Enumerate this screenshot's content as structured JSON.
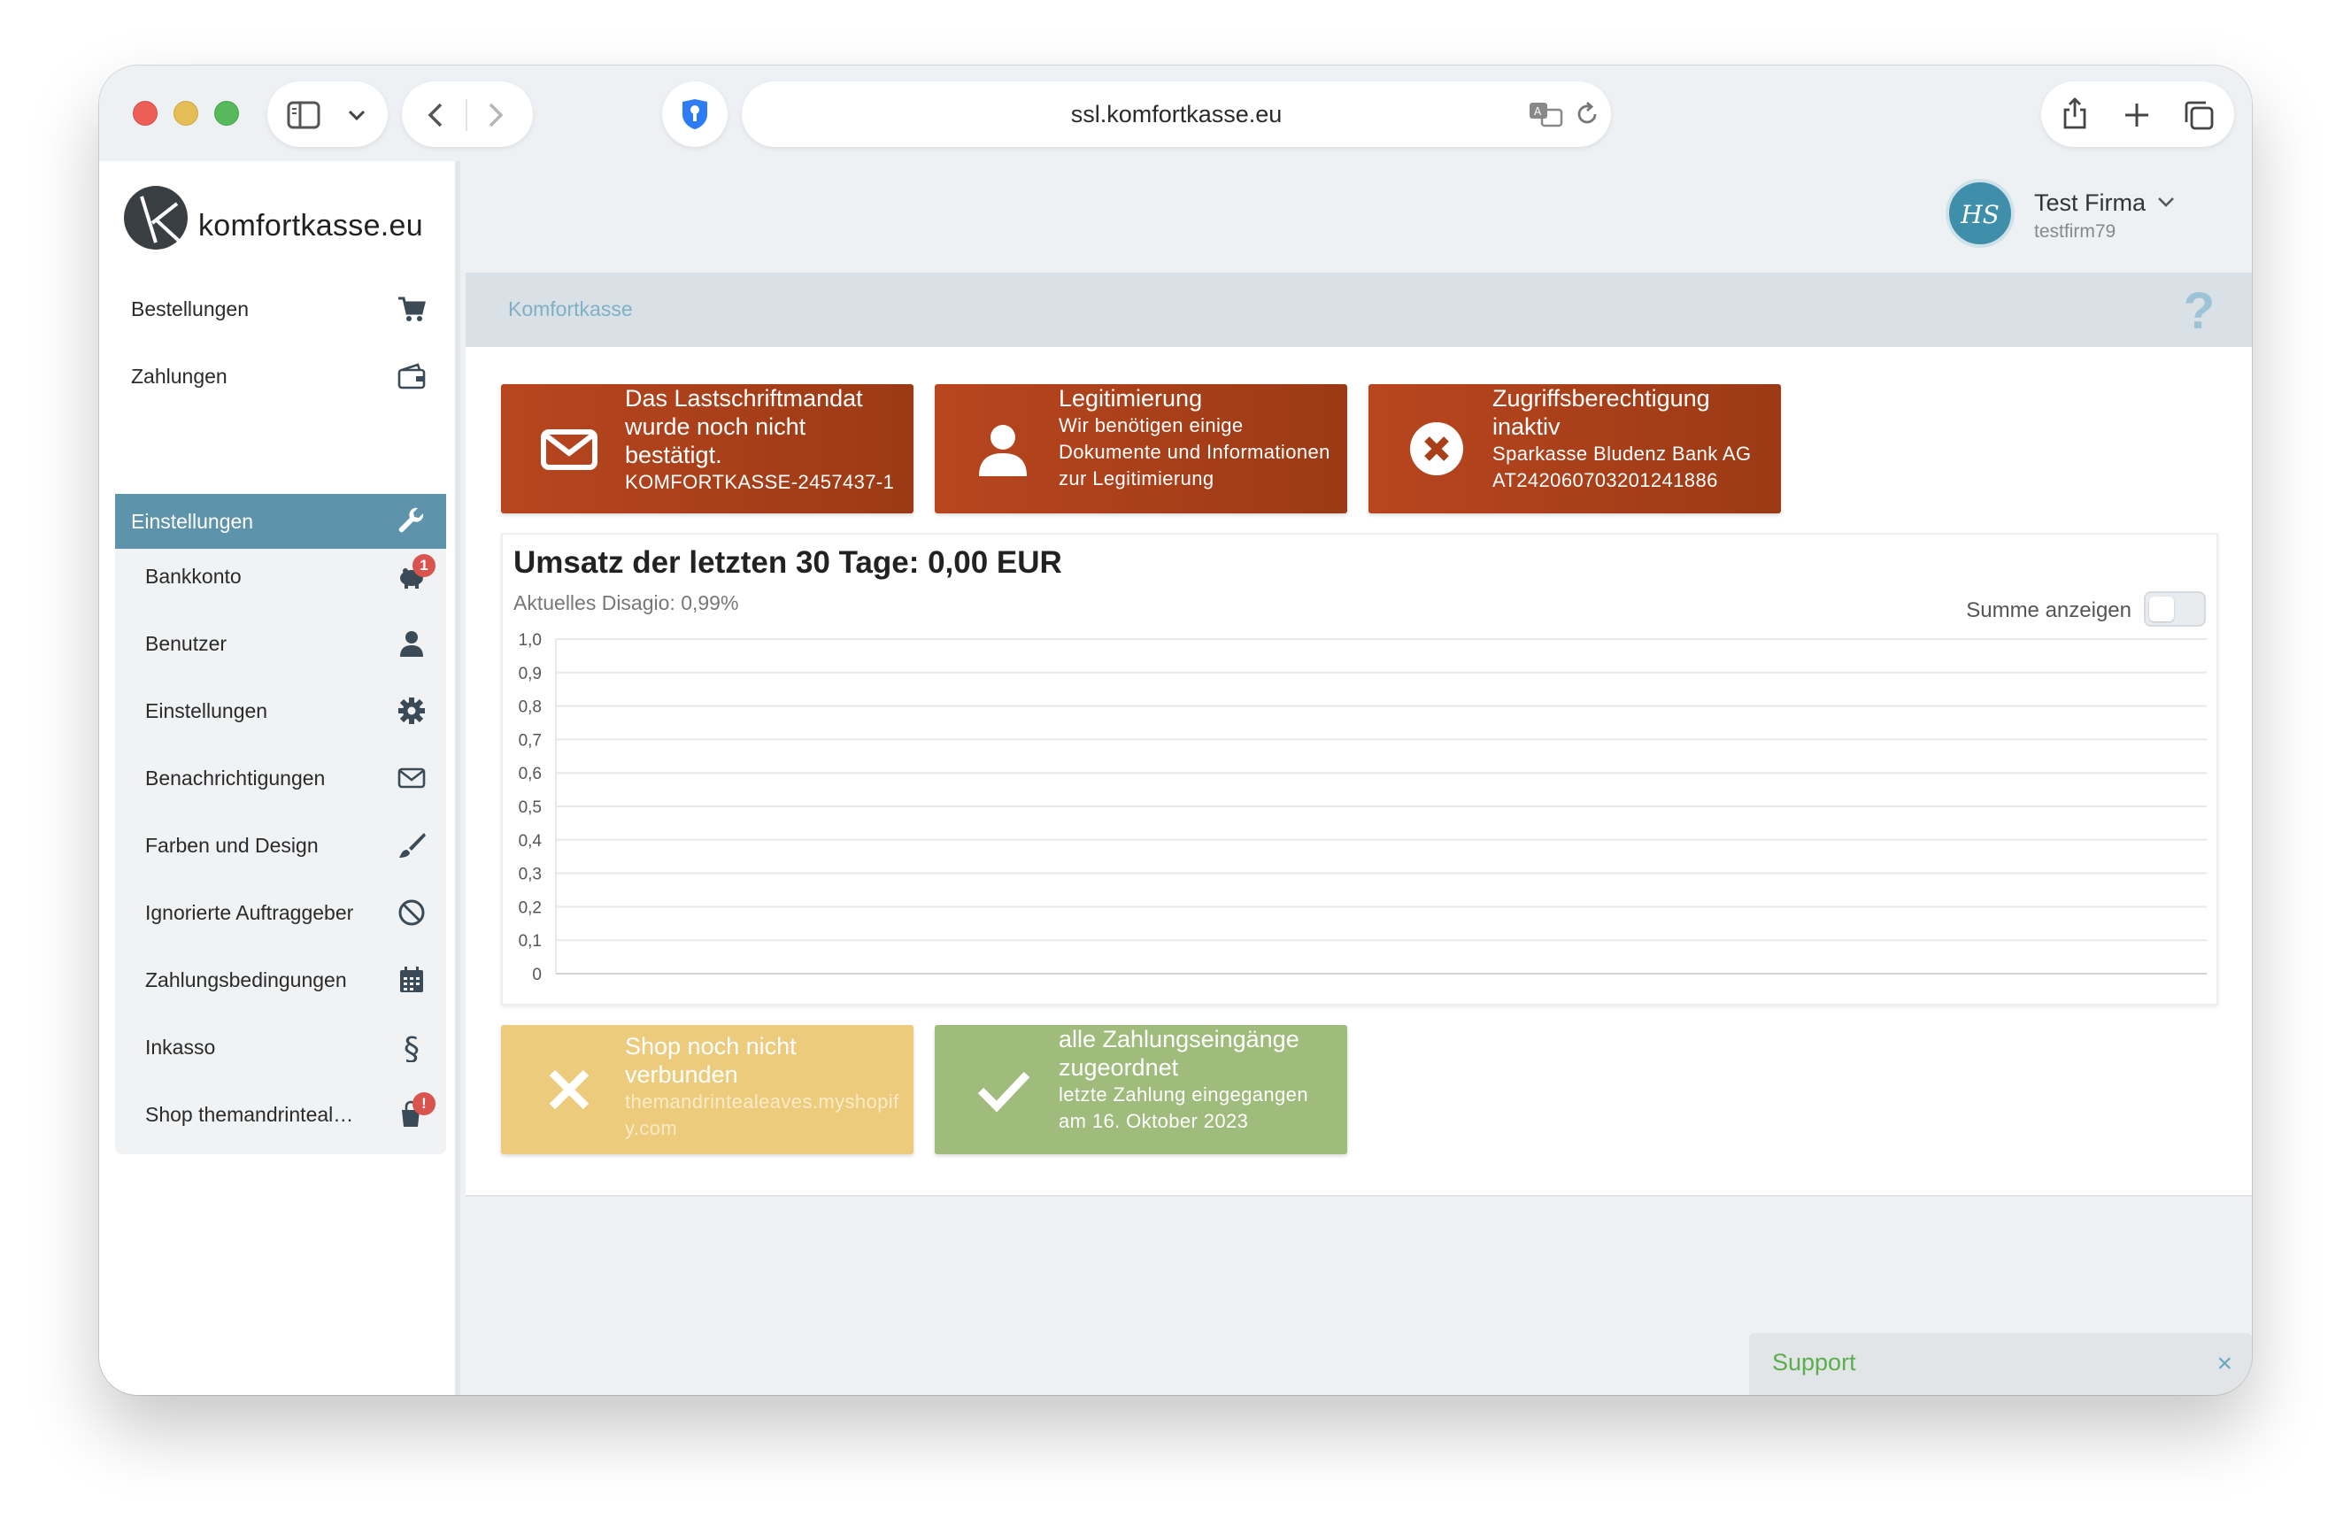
{
  "browser": {
    "url": "ssl.komfortkasse.eu"
  },
  "sidebar": {
    "logo_text": "komfortkasse.eu",
    "items": [
      {
        "label": "Bestellungen",
        "icon": "cart-icon"
      },
      {
        "label": "Zahlungen",
        "icon": "wallet-icon"
      },
      {
        "label": "Einstellungen",
        "icon": "wrench-icon",
        "active": true
      }
    ],
    "subitems": [
      {
        "label": "Bankkonto",
        "icon": "piggy-bank-icon",
        "badge": "1"
      },
      {
        "label": "Benutzer",
        "icon": "user-icon"
      },
      {
        "label": "Einstellungen",
        "icon": "gear-icon"
      },
      {
        "label": "Benachrichtigungen",
        "icon": "envelope-icon"
      },
      {
        "label": "Farben und Design",
        "icon": "paintbrush-icon"
      },
      {
        "label": "Ignorierte Auftraggeber",
        "icon": "ban-icon"
      },
      {
        "label": "Zahlungsbedingungen",
        "icon": "calendar-icon"
      },
      {
        "label": "Inkasso",
        "icon": "paragraph-icon"
      },
      {
        "label": "Shop themandrinteal…",
        "icon": "shop-bag-icon",
        "badge": "!"
      }
    ]
  },
  "header": {
    "user_name": "Test Firma",
    "user_id": "testfirm79",
    "avatar_initials": "HS"
  },
  "breadcrumb": "Komfortkasse",
  "help_label": "?",
  "tiles_top": [
    {
      "title": "Das Lastschriftmandat wurde noch nicht bestätigt.",
      "body": "KOMFORTKASSE-2457437-1",
      "icon": "envelope-icon"
    },
    {
      "title": "Legitimierung",
      "body": "Wir benötigen einige Dokumente und Informationen zur Legitimierung",
      "icon": "user-icon"
    },
    {
      "title": "Zugriffsberechtigung inaktiv",
      "body": "Sparkasse Bludenz Bank AG AT242060703201241886",
      "icon": "x-circle-icon"
    }
  ],
  "chart_card": {
    "title": "Umsatz der letzten 30 Tage: 0,00 EUR",
    "subtitle": "Aktuelles Disagio: 0,99%",
    "toggle_label": "Summe anzeigen",
    "toggle_on": false
  },
  "chart_data": {
    "type": "line",
    "title": "",
    "xlabel": "",
    "ylabel": "",
    "ylim": [
      0,
      1.0
    ],
    "yticks": [
      "0",
      "0,1",
      "0,2",
      "0,3",
      "0,4",
      "0,5",
      "0,6",
      "0,7",
      "0,8",
      "0,9",
      "1,0"
    ],
    "series": [],
    "grid": true
  },
  "tiles_bottom": [
    {
      "title": "Shop noch nicht verbunden",
      "body": "themandrintealeaves.myshopify.com",
      "icon": "x-icon",
      "color": "#edcb7c"
    },
    {
      "title": "alle Zahlungseingänge zugeordnet",
      "body": "letzte Zahlung eingegangen am 16. Oktober 2023",
      "icon": "check-icon",
      "color": "#9fbc7c"
    }
  ],
  "support": {
    "label": "Support",
    "close": "×"
  },
  "colors": {
    "accent": "#5e93ac",
    "alert_red": "#a83f18",
    "warning_yellow": "#edcb7c",
    "success_green": "#9fbc7c"
  }
}
